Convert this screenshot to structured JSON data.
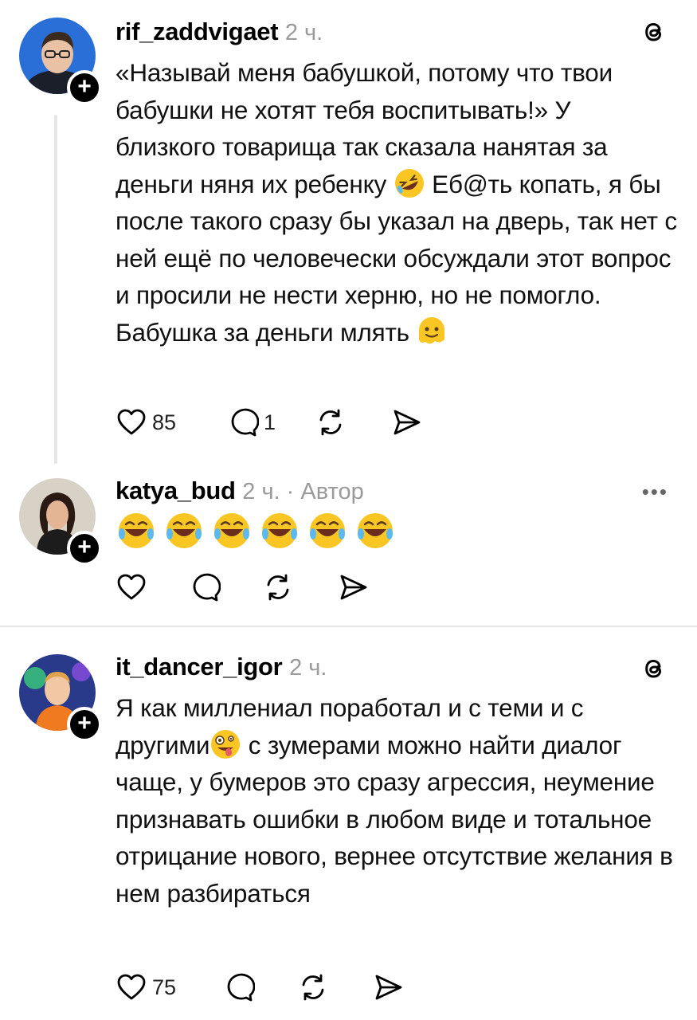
{
  "posts": [
    {
      "username": "rif_zaddvigaet",
      "meta": "2 ч.",
      "text_parts": [
        "«Называй меня бабушкой, потому что твои бабушки не хотят тебя воспитывать!» У близкого товарища так сказала нанятая за деньги няня их ребенку ",
        " Еб@ть копать, я бы после такого сразу бы указал на дверь, так нет с ней ещё по человечески обсуждали этот вопрос и просили не нести херню, но не помогло. Бабушка за деньги млять "
      ],
      "emojis": [
        "rolling-laughing-emoji",
        "melting-face-emoji"
      ],
      "likes": "85",
      "replies": "1",
      "show_threads_logo": true
    },
    {
      "username": "katya_bud",
      "meta": "2 ч. · Автор",
      "emoji_count": 6,
      "emoji": "tears-of-joy-emoji",
      "likes": "",
      "replies": "",
      "more": "•••"
    },
    {
      "username": "it_dancer_igor",
      "meta": "2 ч.",
      "text_parts": [
        "Я как миллениал поработал и с теми и с другими",
        " с зумерами можно найти диалог чаще, у бумеров это сразу агрессия, неумение признавать ошибки в любом виде и тотальное отрицание нового, вернее отсутствие желания в нем разбираться"
      ],
      "emojis": [
        "zany-face-emoji"
      ],
      "likes": "75",
      "replies": "",
      "show_threads_logo": true
    }
  ],
  "icons": [
    "heart-icon",
    "comment-icon",
    "repost-icon",
    "share-icon",
    "threads-logo-icon",
    "plus-icon"
  ],
  "colors": {
    "meta": "#9a9a9a",
    "thread_line": "#e6e6e6",
    "divider": "#e8e8e8"
  }
}
